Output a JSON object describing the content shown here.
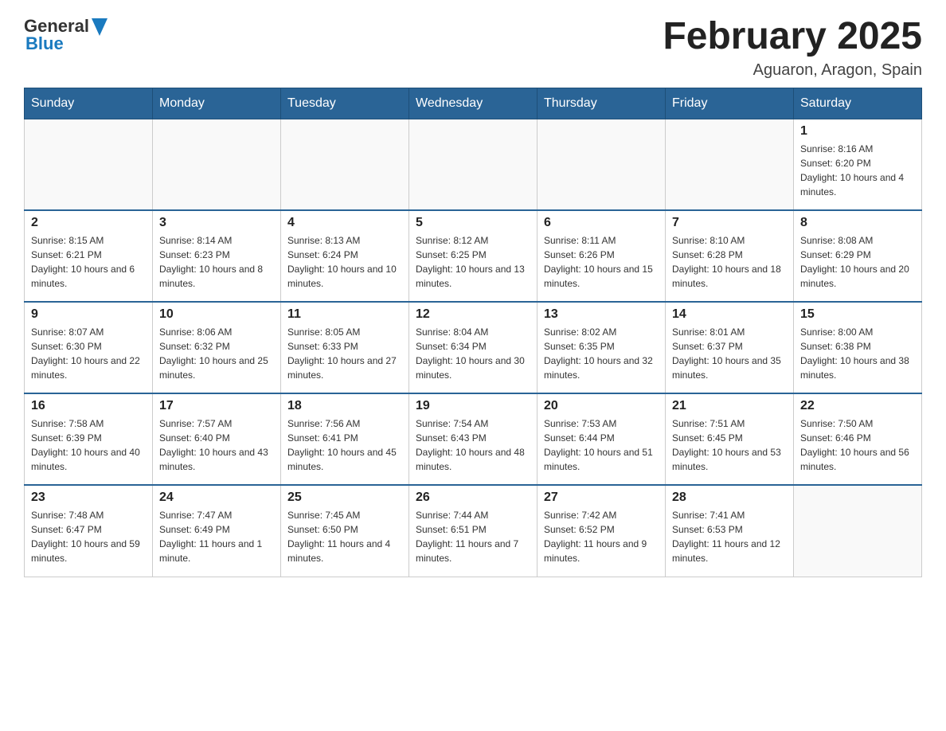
{
  "header": {
    "logo_general": "General",
    "logo_blue": "Blue",
    "title": "February 2025",
    "subtitle": "Aguaron, Aragon, Spain"
  },
  "weekdays": [
    "Sunday",
    "Monday",
    "Tuesday",
    "Wednesday",
    "Thursday",
    "Friday",
    "Saturday"
  ],
  "weeks": [
    [
      {
        "day": "",
        "info": ""
      },
      {
        "day": "",
        "info": ""
      },
      {
        "day": "",
        "info": ""
      },
      {
        "day": "",
        "info": ""
      },
      {
        "day": "",
        "info": ""
      },
      {
        "day": "",
        "info": ""
      },
      {
        "day": "1",
        "info": "Sunrise: 8:16 AM\nSunset: 6:20 PM\nDaylight: 10 hours and 4 minutes."
      }
    ],
    [
      {
        "day": "2",
        "info": "Sunrise: 8:15 AM\nSunset: 6:21 PM\nDaylight: 10 hours and 6 minutes."
      },
      {
        "day": "3",
        "info": "Sunrise: 8:14 AM\nSunset: 6:23 PM\nDaylight: 10 hours and 8 minutes."
      },
      {
        "day": "4",
        "info": "Sunrise: 8:13 AM\nSunset: 6:24 PM\nDaylight: 10 hours and 10 minutes."
      },
      {
        "day": "5",
        "info": "Sunrise: 8:12 AM\nSunset: 6:25 PM\nDaylight: 10 hours and 13 minutes."
      },
      {
        "day": "6",
        "info": "Sunrise: 8:11 AM\nSunset: 6:26 PM\nDaylight: 10 hours and 15 minutes."
      },
      {
        "day": "7",
        "info": "Sunrise: 8:10 AM\nSunset: 6:28 PM\nDaylight: 10 hours and 18 minutes."
      },
      {
        "day": "8",
        "info": "Sunrise: 8:08 AM\nSunset: 6:29 PM\nDaylight: 10 hours and 20 minutes."
      }
    ],
    [
      {
        "day": "9",
        "info": "Sunrise: 8:07 AM\nSunset: 6:30 PM\nDaylight: 10 hours and 22 minutes."
      },
      {
        "day": "10",
        "info": "Sunrise: 8:06 AM\nSunset: 6:32 PM\nDaylight: 10 hours and 25 minutes."
      },
      {
        "day": "11",
        "info": "Sunrise: 8:05 AM\nSunset: 6:33 PM\nDaylight: 10 hours and 27 minutes."
      },
      {
        "day": "12",
        "info": "Sunrise: 8:04 AM\nSunset: 6:34 PM\nDaylight: 10 hours and 30 minutes."
      },
      {
        "day": "13",
        "info": "Sunrise: 8:02 AM\nSunset: 6:35 PM\nDaylight: 10 hours and 32 minutes."
      },
      {
        "day": "14",
        "info": "Sunrise: 8:01 AM\nSunset: 6:37 PM\nDaylight: 10 hours and 35 minutes."
      },
      {
        "day": "15",
        "info": "Sunrise: 8:00 AM\nSunset: 6:38 PM\nDaylight: 10 hours and 38 minutes."
      }
    ],
    [
      {
        "day": "16",
        "info": "Sunrise: 7:58 AM\nSunset: 6:39 PM\nDaylight: 10 hours and 40 minutes."
      },
      {
        "day": "17",
        "info": "Sunrise: 7:57 AM\nSunset: 6:40 PM\nDaylight: 10 hours and 43 minutes."
      },
      {
        "day": "18",
        "info": "Sunrise: 7:56 AM\nSunset: 6:41 PM\nDaylight: 10 hours and 45 minutes."
      },
      {
        "day": "19",
        "info": "Sunrise: 7:54 AM\nSunset: 6:43 PM\nDaylight: 10 hours and 48 minutes."
      },
      {
        "day": "20",
        "info": "Sunrise: 7:53 AM\nSunset: 6:44 PM\nDaylight: 10 hours and 51 minutes."
      },
      {
        "day": "21",
        "info": "Sunrise: 7:51 AM\nSunset: 6:45 PM\nDaylight: 10 hours and 53 minutes."
      },
      {
        "day": "22",
        "info": "Sunrise: 7:50 AM\nSunset: 6:46 PM\nDaylight: 10 hours and 56 minutes."
      }
    ],
    [
      {
        "day": "23",
        "info": "Sunrise: 7:48 AM\nSunset: 6:47 PM\nDaylight: 10 hours and 59 minutes."
      },
      {
        "day": "24",
        "info": "Sunrise: 7:47 AM\nSunset: 6:49 PM\nDaylight: 11 hours and 1 minute."
      },
      {
        "day": "25",
        "info": "Sunrise: 7:45 AM\nSunset: 6:50 PM\nDaylight: 11 hours and 4 minutes."
      },
      {
        "day": "26",
        "info": "Sunrise: 7:44 AM\nSunset: 6:51 PM\nDaylight: 11 hours and 7 minutes."
      },
      {
        "day": "27",
        "info": "Sunrise: 7:42 AM\nSunset: 6:52 PM\nDaylight: 11 hours and 9 minutes."
      },
      {
        "day": "28",
        "info": "Sunrise: 7:41 AM\nSunset: 6:53 PM\nDaylight: 11 hours and 12 minutes."
      },
      {
        "day": "",
        "info": ""
      }
    ]
  ]
}
